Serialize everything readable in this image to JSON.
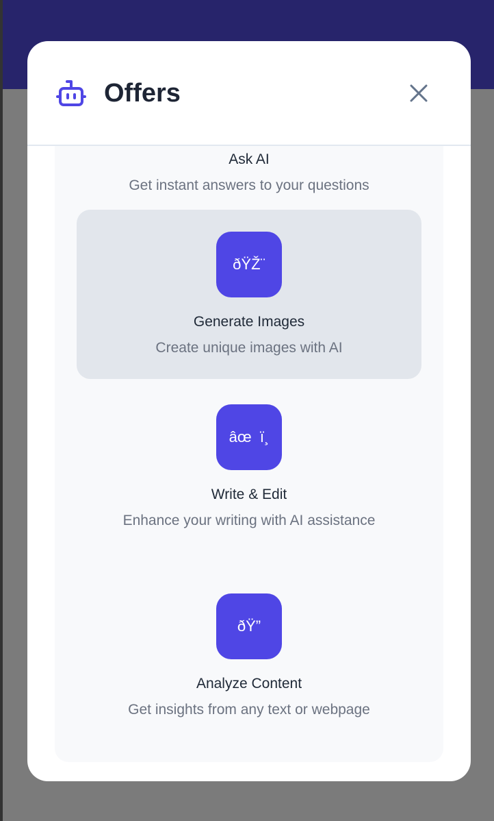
{
  "modal": {
    "title": "Offers",
    "close_label": "Close"
  },
  "items": [
    {
      "icon": "",
      "title": "Ask AI",
      "desc": "Get instant answers to your questions"
    },
    {
      "icon": "ðŸŽ¨",
      "title": "Generate Images",
      "desc": "Create unique images with AI"
    },
    {
      "icon": "âœ  ï¸",
      "title": "Write & Edit",
      "desc": "Enhance your writing with AI assistance"
    },
    {
      "icon": "ðŸ”",
      "title": "Analyze Content",
      "desc": "Get insights from any text or webpage"
    }
  ],
  "colors": {
    "accent": "#4f46e5",
    "highlight": "#e2e6ec",
    "backdrop_top": "#27246b"
  }
}
